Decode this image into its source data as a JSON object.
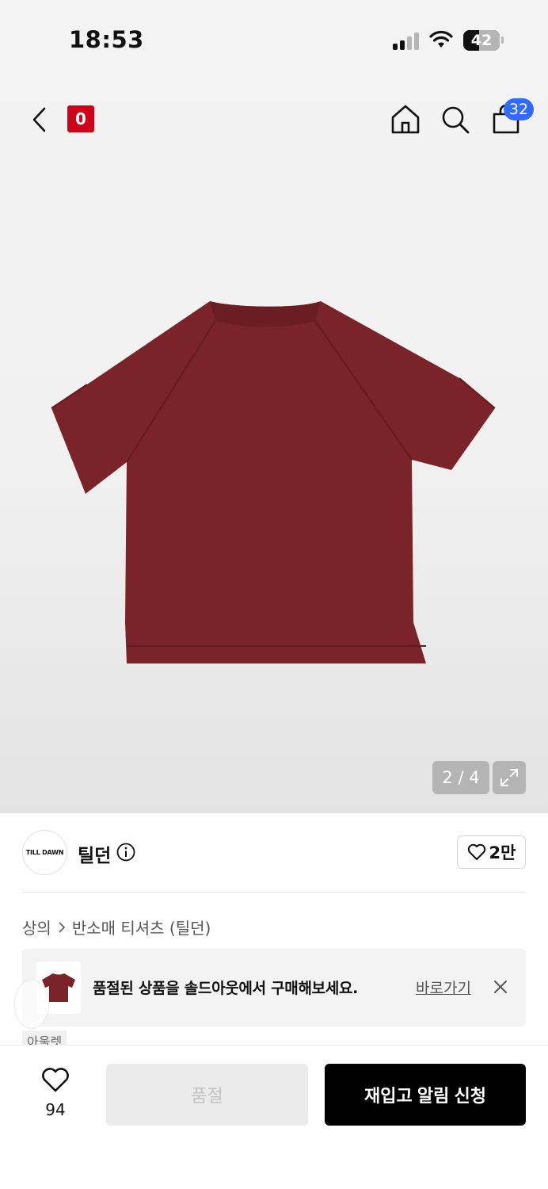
{
  "status_bar": {
    "time": "18:53",
    "battery": "42"
  },
  "header": {
    "logo_text": "0",
    "cart_count": "32"
  },
  "gallery": {
    "page_indicator": "2 / 4",
    "product_color": "#7a2328"
  },
  "brand": {
    "logo_text": "TILL DAWN",
    "name": "틸던",
    "like_count": "2만"
  },
  "breadcrumb": {
    "category": "상의",
    "subcategory": "반소매 티셔츠 (틸던)"
  },
  "banner": {
    "message": "품절된 상품을 솔드아웃에서 구매해보세요.",
    "link_label": "바로가기"
  },
  "outlet": {
    "label": "아울렛"
  },
  "bottom_bar": {
    "wish_count": "94",
    "soldout_label": "품절",
    "restock_label": "재입고 알림 신청"
  },
  "colors": {
    "accent": "#2f6bff",
    "brand_red": "#d0021b",
    "primary_button": "#000000"
  }
}
